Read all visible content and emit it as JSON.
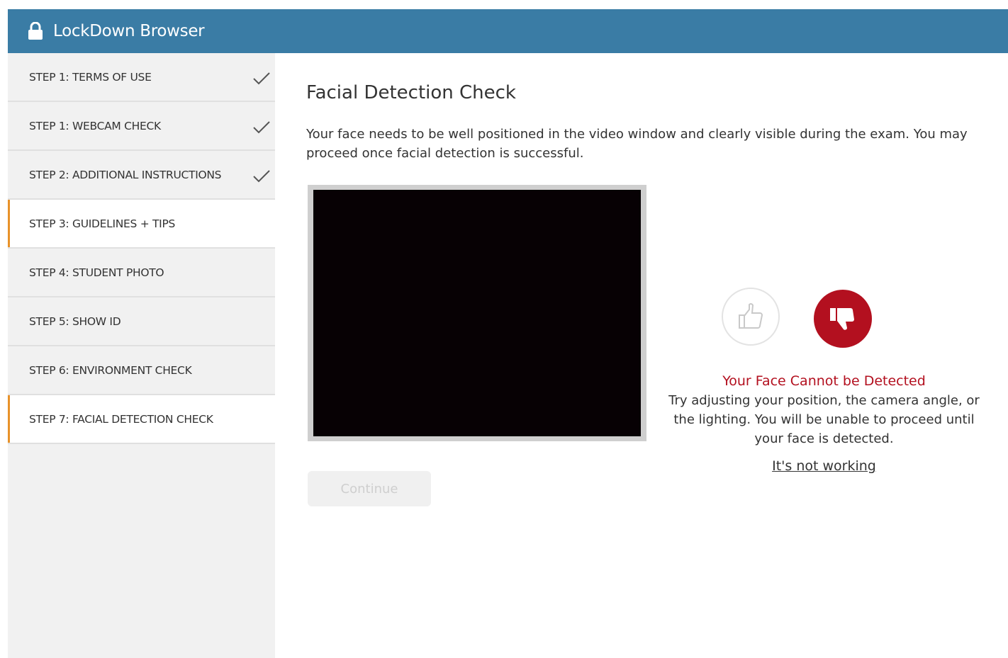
{
  "app": {
    "title": "LockDown Browser"
  },
  "steps": [
    {
      "label": "STEP 1: TERMS OF USE",
      "completed": true,
      "active": false
    },
    {
      "label": "STEP 1: WEBCAM CHECK",
      "completed": true,
      "active": false
    },
    {
      "label": "STEP 2: ADDITIONAL INSTRUCTIONS",
      "completed": true,
      "active": false
    },
    {
      "label": "STEP 3: GUIDELINES + TIPS",
      "completed": false,
      "active": true
    },
    {
      "label": "STEP 4: STUDENT PHOTO",
      "completed": false,
      "active": false
    },
    {
      "label": "STEP 5: SHOW ID",
      "completed": false,
      "active": false
    },
    {
      "label": "STEP 6: ENVIRONMENT CHECK",
      "completed": false,
      "active": false
    },
    {
      "label": "STEP 7: FACIAL DETECTION CHECK",
      "completed": false,
      "active": true
    }
  ],
  "main": {
    "title": "Facial Detection Check",
    "intro": "Your face needs to be well positioned in the video window and clearly visible during the exam. You may proceed once facial detection is successful.",
    "continue_label": "Continue",
    "status_error": "Your Face Cannot be Detected",
    "status_message": "Try adjusting your position, the camera angle, or the lighting. You will be unable to proceed until your face is detected.",
    "help_link": "It's not working"
  },
  "colors": {
    "header": "#3a7ca5",
    "accent": "#e8922a",
    "error": "#b3101f"
  },
  "icons": {
    "lock": "lock-icon",
    "check": "checkmark-icon",
    "thumb_up": "thumbs-up-icon",
    "thumb_down": "thumbs-down-icon"
  }
}
